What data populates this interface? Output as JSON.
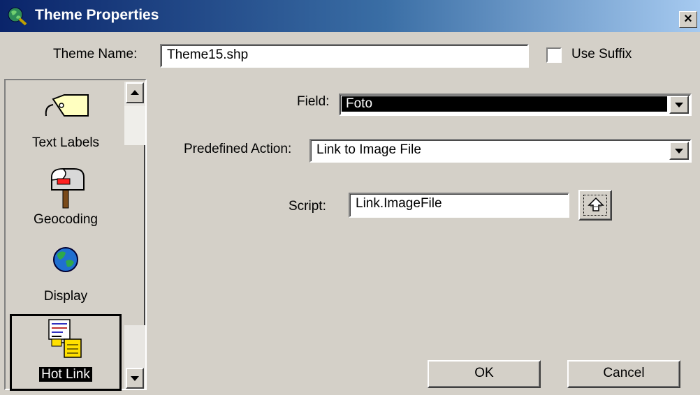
{
  "window": {
    "title": "Theme Properties",
    "close_label": "×"
  },
  "theme_name": {
    "label": "Theme Name:",
    "value": "Theme15.shp"
  },
  "use_suffix": {
    "label": "Use Suffix",
    "checked": false
  },
  "categories": [
    {
      "label": "Text Labels",
      "icon": "tag-icon",
      "selected": false
    },
    {
      "label": "Geocoding",
      "icon": "mailbox-icon",
      "selected": false
    },
    {
      "label": "Display",
      "icon": "globe-icon",
      "selected": false
    },
    {
      "label": "Hot Link",
      "icon": "hotlink-icon",
      "selected": true
    }
  ],
  "field": {
    "label": "Field:",
    "value": "Foto"
  },
  "predefined_action": {
    "label": "Predefined Action:",
    "value": "Link to Image File"
  },
  "script": {
    "label": "Script:",
    "value": "Link.ImageFile",
    "browse_icon": "script-browse-icon"
  },
  "buttons": {
    "ok": "OK",
    "cancel": "Cancel"
  },
  "colors": {
    "face": "#d4d0c8",
    "title_start": "#0a246a",
    "title_end": "#a6caf0",
    "selection": "#000000"
  }
}
